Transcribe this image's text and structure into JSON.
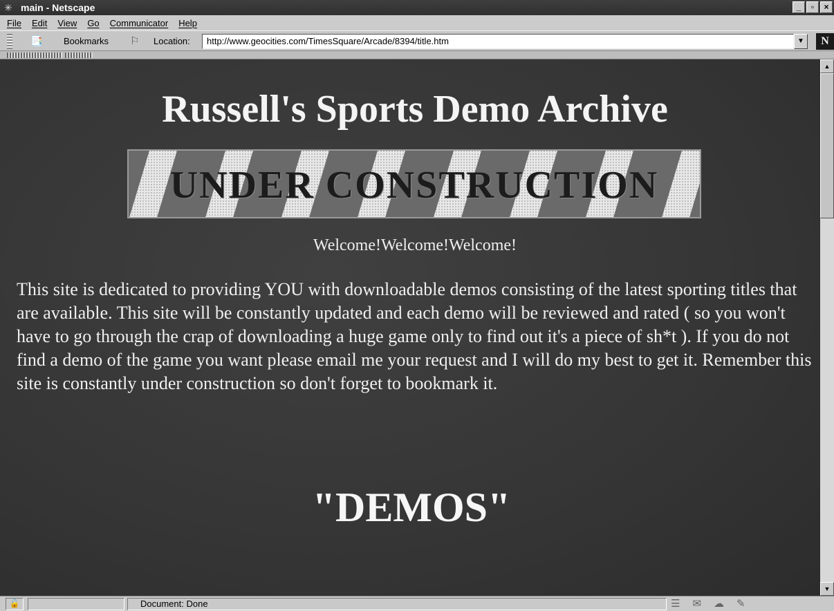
{
  "window": {
    "title": "main - Netscape",
    "controls": [
      "_",
      "▫",
      "×"
    ]
  },
  "menu": [
    "File",
    "Edit",
    "View",
    "Go",
    "Communicator",
    "Help"
  ],
  "toolbar": {
    "bookmarks_label": "Bookmarks",
    "location_label": "Location:",
    "url": "http://www.geocities.com/TimesSquare/Arcade/8394/title.htm",
    "netscape_logo": "N"
  },
  "page": {
    "heading": "Russell's Sports Demo Archive",
    "banner_text": "UNDER CONSTRUCTION",
    "welcome": "Welcome!Welcome!Welcome!",
    "intro": "This site is dedicated to providing YOU with downloadable demos consisting of the latest sporting titles that are available. This site will be constantly updated and each demo will be reviewed and rated ( so you won't have to go through the crap of downloading a huge game only to find out it's a piece of sh*t ). If you do not find a demo of the game you want please email me your request and I will do my best to get it. Remember this site is constantly under construction so don't forget to bookmark it.",
    "demos_heading": "\"DEMOS\""
  },
  "status": {
    "text": "Document: Done"
  },
  "icons": {
    "app": "netscape-app-icon",
    "bookmarks": "bookmarks-icon",
    "location": "location-icon",
    "lock": "security-lock-icon"
  }
}
